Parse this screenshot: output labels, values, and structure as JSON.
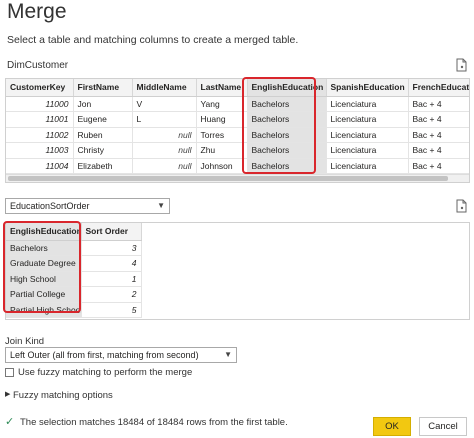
{
  "dialog": {
    "title": "Merge",
    "subtitle": "Select a table and matching columns to create a merged table."
  },
  "top_table": {
    "name": "DimCustomer",
    "columns": [
      "CustomerKey",
      "FirstName",
      "MiddleName",
      "LastName",
      "EnglishEducation",
      "SpanishEducation",
      "FrenchEducation"
    ],
    "rows": [
      [
        "11000",
        "Jon",
        "V",
        "Yang",
        "Bachelors",
        "Licenciatura",
        "Bac + 4"
      ],
      [
        "11001",
        "Eugene",
        "L",
        "Huang",
        "Bachelors",
        "Licenciatura",
        "Bac + 4"
      ],
      [
        "11002",
        "Ruben",
        "null",
        "Torres",
        "Bachelors",
        "Licenciatura",
        "Bac + 4"
      ],
      [
        "11003",
        "Christy",
        "null",
        "Zhu",
        "Bachelors",
        "Licenciatura",
        "Bac + 4"
      ],
      [
        "11004",
        "Elizabeth",
        "null",
        "Johnson",
        "Bachelors",
        "Licenciatura",
        "Bac + 4"
      ]
    ]
  },
  "second_table": {
    "selected": "EducationSortOrder",
    "columns": [
      "EnglishEducation",
      "Sort Order"
    ],
    "rows": [
      [
        "Bachelors",
        "3"
      ],
      [
        "Graduate Degree",
        "4"
      ],
      [
        "High School",
        "1"
      ],
      [
        "Partial College",
        "2"
      ],
      [
        "Partial High School",
        "5"
      ]
    ]
  },
  "join_kind": {
    "label": "Join Kind",
    "selected": "Left Outer (all from first, matching from second)"
  },
  "fuzzy": {
    "checkbox_label": "Use fuzzy matching to perform the merge",
    "options_label": "Fuzzy matching options",
    "checked": false
  },
  "status": {
    "message": "The selection matches 18484 of 18484 rows from the first table.",
    "color": "#2e8b57"
  },
  "buttons": {
    "ok": "OK",
    "cancel": "Cancel"
  },
  "colors": {
    "highlight": "#d9262c",
    "ok_button": "#f2c811"
  },
  "icons": {
    "preview": "file-preview-icon",
    "expand": "triangle-right-icon",
    "check": "checkmark-icon"
  }
}
